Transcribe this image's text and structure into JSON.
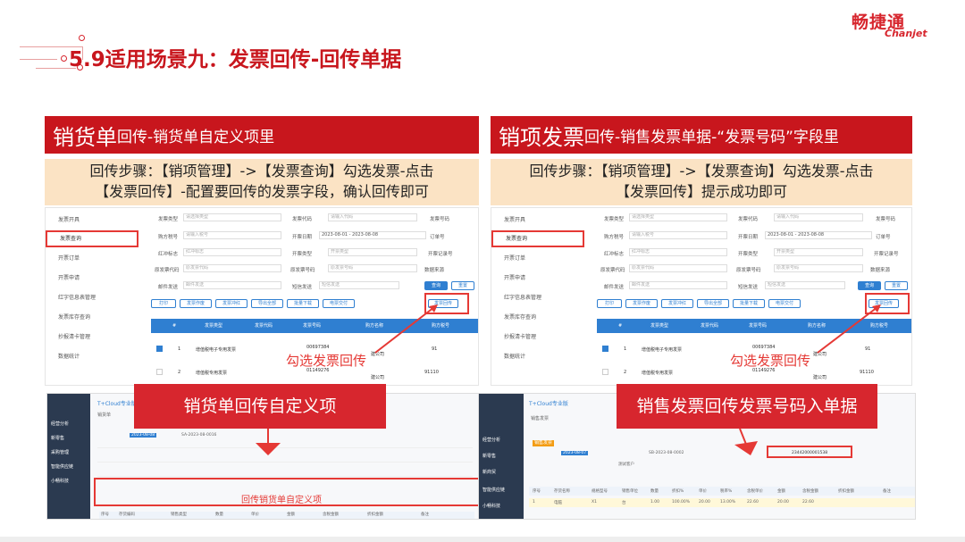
{
  "brand": {
    "cn": "畅捷通",
    "en": "Chanjet",
    "color": "#d7262e"
  },
  "page_title": "5.9适用场景九：发票回传-回传单据",
  "left": {
    "banner_big": "销货单",
    "banner_small": "回传-销货单自定义项里",
    "step_line1": "回传步骤：【销项管理】->【发票查询】勾选发票-点击",
    "step_line2": "【发票回传】-配置要回传的发票字段，确认回传即可",
    "callout_select": "勾选发票回传",
    "overlay": "销货单回传自定义项",
    "thumb_label": "回传销货单自定义项"
  },
  "right": {
    "banner_big": "销项发票",
    "banner_small": "回传-销售发票单据-“发票号码”字段里",
    "step_line1": "回传步骤：【销项管理】->【发票查询】勾选发票-点击",
    "step_line2": "【发票回传】提示成功即可",
    "callout_select": "勾选发票回传",
    "overlay": "销售发票回传发票号码入单据"
  },
  "app": {
    "sidebar": [
      "发票开具",
      "发票查询",
      "开票订单",
      "开票申请",
      "红字信息表管理",
      "发票库存查询",
      "抄报清卡管理",
      "数据统计"
    ],
    "filters": {
      "invoice_type": "发票类型",
      "invoice_type_ph": "请选择类型",
      "invoice_code": "发票代码",
      "invoice_code_ph": "请输入代码",
      "invoice_no": "发票号码",
      "buyer_tax": "购方税号",
      "buyer_tax_ph": "请输入税号",
      "date": "开票日期",
      "date_from": "2023-08-01",
      "date_to": "2023-08-08",
      "order_no": "订单号",
      "red_flag": "红冲标志",
      "red_flag_ph": "红冲标志",
      "invoice_state": "开票类型",
      "invoice_state_ph": "开票类型",
      "record_no": "开票记录号",
      "orig_code": "原发票代码",
      "orig_code_ph": "原发票代码",
      "orig_no": "原发票号码",
      "orig_no_ph": "原发票号码",
      "source": "数据来源",
      "mail": "邮件发送",
      "mail_ph": "邮件发送",
      "sms": "短信发送",
      "sms_ph": "短信发送",
      "query": "查询",
      "reset": "重置"
    },
    "toolbar": [
      "打印",
      "发票作废",
      "发票冲红",
      "导出全部",
      "批量下载",
      "电票交付",
      "发票回传"
    ],
    "table_headers": [
      "#",
      "发票类型",
      "发票代码",
      "发票号码",
      "购方名称",
      "购方税号"
    ],
    "rows": [
      {
        "n": "1",
        "type": "增值税电子专用发票",
        "no": "00697384",
        "buyer": "建公司",
        "tax": "91"
      },
      {
        "n": "2",
        "type": "增值税专用发票",
        "no": "01149276",
        "buyer": "建公司",
        "tax": "91110"
      }
    ]
  },
  "left_thumb": {
    "app": "T+Cloud专业版",
    "side": [
      "经营分析",
      "新零售",
      "采购管理",
      "智能供应链",
      "小畅科技"
    ],
    "tab": "销货单",
    "date": "2023-08-08",
    "bill_no": "SA-2023-08-0016",
    "cols": [
      "序号",
      "存货编码",
      "销售类型",
      "数量",
      "单价",
      "金额",
      "含税金额",
      "折扣金额",
      "备注"
    ]
  },
  "right_thumb": {
    "app": "T+Cloud专业版",
    "side": [
      "经营分析",
      "新零售",
      "新商贸",
      "智能供应链",
      "小畅科技"
    ],
    "tab": "销售发票",
    "date": "2023-08-07",
    "bill_no": "SB-2023-08-0002",
    "invoice_no": "23442000001538",
    "customer": "测试客户",
    "cols": [
      "序号",
      "存货名称",
      "规格型号",
      "销售单位",
      "数量",
      "折扣%",
      "单价",
      "税率%",
      "含税单价",
      "金额",
      "含税金额",
      "折扣金额",
      "备注"
    ],
    "row": [
      "1",
      "电脑",
      "X1",
      "台",
      "1.00",
      "100.00%",
      "20.00",
      "13.00%",
      "22.60",
      "20.00",
      "22.60"
    ]
  }
}
